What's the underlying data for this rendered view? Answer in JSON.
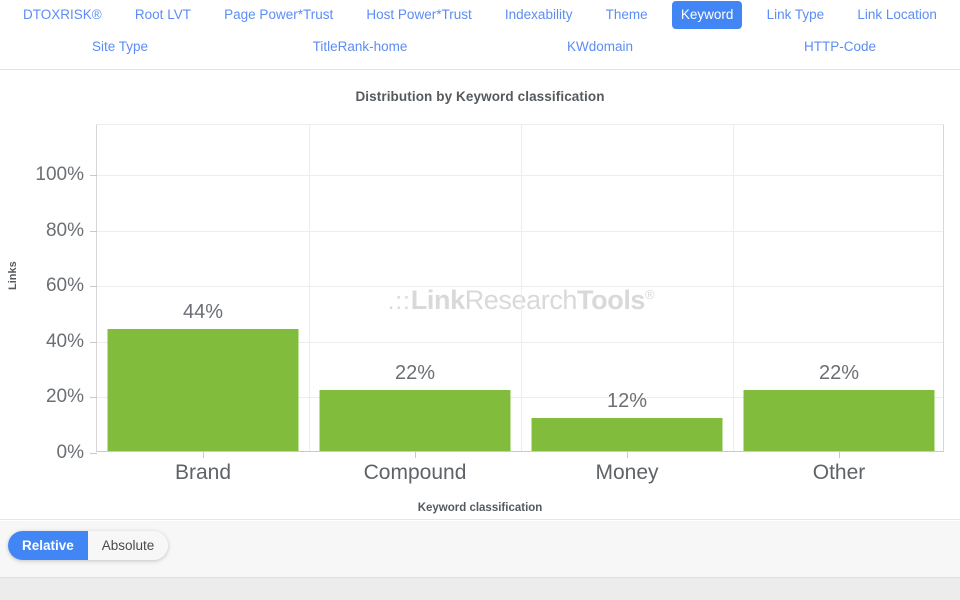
{
  "tabs": {
    "row1": [
      {
        "label": "DTOXRISK®",
        "active": false
      },
      {
        "label": "Root LVT",
        "active": false
      },
      {
        "label": "Page Power*Trust",
        "active": false
      },
      {
        "label": "Host Power*Trust",
        "active": false
      },
      {
        "label": "Indexability",
        "active": false
      },
      {
        "label": "Theme",
        "active": false
      },
      {
        "label": "Keyword",
        "active": true
      },
      {
        "label": "Link Type",
        "active": false
      },
      {
        "label": "Link Location",
        "active": false
      }
    ],
    "row2": [
      {
        "label": "Site Type",
        "active": false
      },
      {
        "label": "TitleRank-home",
        "active": false
      },
      {
        "label": "KWdomain",
        "active": false
      },
      {
        "label": "HTTP-Code",
        "active": false
      }
    ]
  },
  "watermark": {
    "dots": ".::",
    "part1": "Link",
    "part2": "Research",
    "part3": "Tools",
    "registered": "®"
  },
  "footer": {
    "toggle": [
      {
        "label": "Relative",
        "active": true
      },
      {
        "label": "Absolute",
        "active": false
      }
    ]
  },
  "colors": {
    "bar": "#82bc3c",
    "accent": "#4285f4",
    "link": "#5c8df6",
    "grid": "#ededed",
    "axis": "#c9c9c9",
    "watermark": "#d9d9d9",
    "footer_bg": "#f7f7f7"
  },
  "chart_data": {
    "type": "bar",
    "title": "Distribution by Keyword classification",
    "xlabel": "Keyword classification",
    "ylabel": "Links",
    "categories": [
      "Brand",
      "Compound",
      "Money",
      "Other"
    ],
    "values": [
      44,
      22,
      12,
      22
    ],
    "value_labels": [
      "44%",
      "22%",
      "12%",
      "22%"
    ],
    "ylim": [
      0,
      118
    ],
    "yticks": [
      0,
      20,
      40,
      60,
      80,
      100
    ],
    "ytick_labels": [
      "0%",
      "20%",
      "40%",
      "60%",
      "80%",
      "100%"
    ],
    "grid": true,
    "legend": false,
    "series": [
      {
        "name": "Links",
        "values": [
          44,
          22,
          12,
          22
        ],
        "color": "#82bc3c"
      }
    ]
  }
}
